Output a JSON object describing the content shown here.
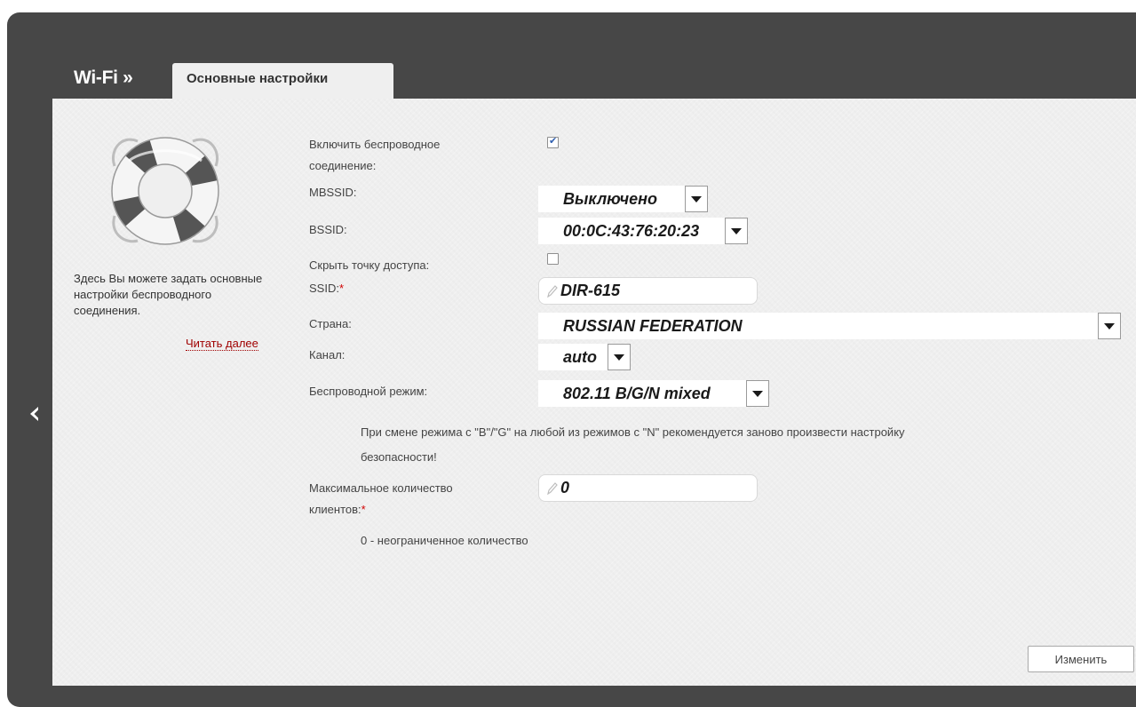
{
  "header": {
    "section_title": "Wi-Fi »",
    "active_tab": "Основные настройки"
  },
  "help": {
    "text": "Здесь Вы можете задать основные настройки беспроводного соединения.",
    "read_more": "Читать далее"
  },
  "form": {
    "enable_wireless": {
      "label": "Включить беспроводное соединение:",
      "checked": true
    },
    "mbssid": {
      "label": "MBSSID:",
      "value": "Выключено"
    },
    "bssid": {
      "label": "BSSID:",
      "value": "00:0C:43:76:20:23"
    },
    "hide_ap": {
      "label": "Скрыть точку доступа:",
      "checked": false
    },
    "ssid": {
      "label": "SSID:",
      "required_mark": "*",
      "value": "DIR-615"
    },
    "country": {
      "label": "Страна:",
      "value": "RUSSIAN FEDERATION"
    },
    "channel": {
      "label": "Канал:",
      "value": "auto"
    },
    "wireless_mode": {
      "label": "Беспроводной режим:",
      "value": "802.11 B/G/N mixed"
    },
    "mode_note_line1": "При смене режима с \"B\"/\"G\" на любой из режимов с \"N\" рекомендуется заново произвести настройку",
    "mode_note_line2": "безопасности!",
    "max_clients": {
      "label": "Максимальное количество клиентов:",
      "required_mark": "*",
      "value": "0"
    },
    "max_clients_note": "0 - неограниченное количество"
  },
  "buttons": {
    "apply": "Изменить"
  },
  "colors": {
    "frame": "#474747",
    "panel": "#efefef",
    "required": "#d00000",
    "link": "#a00000"
  }
}
